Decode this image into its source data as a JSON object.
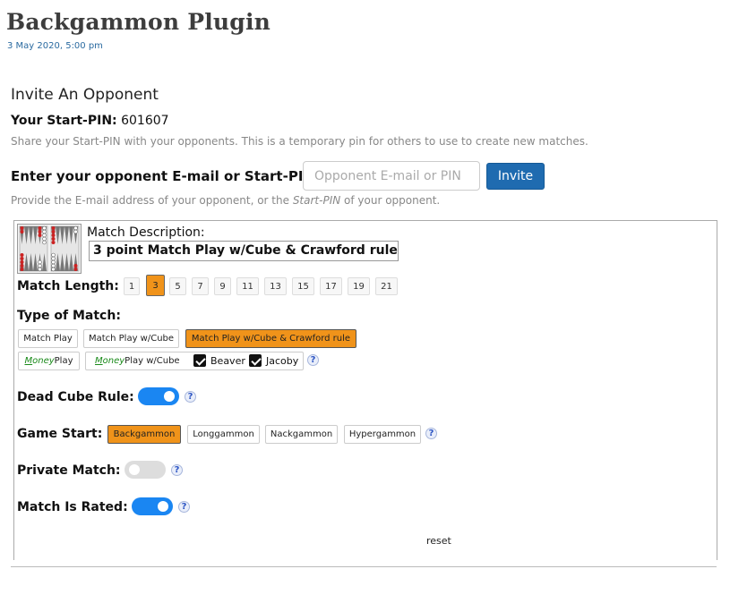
{
  "page": {
    "title": "Backgammon Plugin",
    "date": "3 May 2020, 5:00 pm"
  },
  "invite": {
    "heading": "Invite An Opponent",
    "pin_label": "Your Start-PIN:",
    "pin_value": "601607",
    "pin_help": "Share your Start-PIN with your opponents. This is a temporary pin for others to use to create new matches.",
    "opponent_label": "Enter your opponent E-mail or Start-PIN:",
    "opponent_placeholder": "Opponent E-mail or PIN",
    "opponent_value": "",
    "invite_button": "Invite",
    "opponent_help_pre": "Provide the E-mail address of your opponent, or the ",
    "opponent_help_em": "Start-PIN",
    "opponent_help_post": " of your opponent."
  },
  "match": {
    "description_label": "Match Description:",
    "description_value": "3 point Match Play w/Cube & Crawford rule",
    "length_label": "Match Length:",
    "lengths": [
      "1",
      "3",
      "5",
      "7",
      "9",
      "11",
      "13",
      "15",
      "17",
      "19",
      "21"
    ],
    "selected_length": "3",
    "type_label": "Type of Match:",
    "types_row1": [
      "Match Play",
      "Match Play w/Cube",
      "Match Play w/Cube & Crawford rule"
    ],
    "selected_type": "Match Play w/Cube & Crawford rule",
    "money_play_prefix": "M",
    "money_play_rest": "oney",
    "money_play_suffix": " Play",
    "money_cube_prefix": "M",
    "money_cube_rest": "oney",
    "money_cube_suffix": " Play w/Cube",
    "beaver_label": "Beaver",
    "beaver_checked": true,
    "jacoby_label": "Jacoby",
    "jacoby_checked": true,
    "dead_cube_label": "Dead Cube Rule:",
    "dead_cube_on": true,
    "game_start_label": "Game Start:",
    "game_starts": [
      "Backgammon",
      "Longgammon",
      "Nackgammon",
      "Hypergammon"
    ],
    "selected_game_start": "Backgammon",
    "private_label": "Private Match:",
    "private_on": false,
    "rated_label": "Match Is Rated:",
    "rated_on": true,
    "reset_label": "reset",
    "help_glyph": "?"
  },
  "icons": {
    "board": "backgammon-board-icon",
    "help": "help-icon",
    "check": "checkbox-checked-icon"
  },
  "colors": {
    "selected": "#f0931a",
    "toggle_on": "#1a86f2",
    "toggle_off": "#dddddd",
    "invite_button": "#1f6bb0",
    "money_text": "#1a8a1a",
    "board_checker": "#cc2222"
  }
}
